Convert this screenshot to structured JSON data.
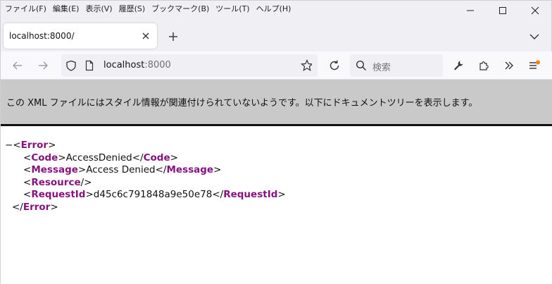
{
  "menu": [
    "ファイル(F)",
    "編集(E)",
    "表示(V)",
    "履歴(S)",
    "ブックマーク(B)",
    "ツール(T)",
    "ヘルプ(H)"
  ],
  "tab": {
    "title": "localhost:8000/"
  },
  "url": {
    "host": "localhost",
    "port": ":8000"
  },
  "search": {
    "placeholder": "検索"
  },
  "infobar": {
    "message": "この XML ファイルにはスタイル情報が関連付けられていないようです。以下にドキュメントツリーを表示します。"
  },
  "xml": {
    "collapse_toggle": "−",
    "root_tag": "Error",
    "code_tag": "Code",
    "code_value": "AccessDenied",
    "message_tag": "Message",
    "message_value": "Access Denied",
    "resource_tag": "Resource",
    "requestid_tag": "RequestId",
    "requestid_value": "d45c6c791848a9e50e78"
  },
  "colors": {
    "tag": "#881280",
    "infobar": "#c9c9c9",
    "accent_dot": "#f5820b"
  }
}
